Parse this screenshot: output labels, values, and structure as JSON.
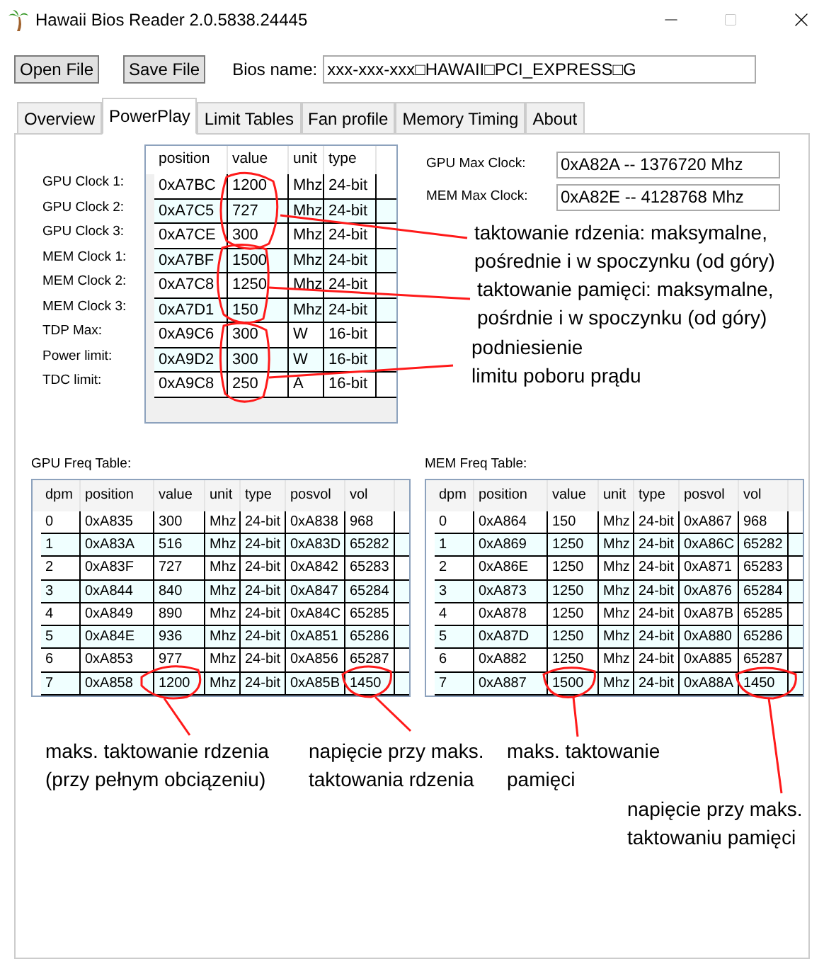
{
  "window": {
    "title": "Hawaii Bios Reader 2.0.5838.24445"
  },
  "toolbar": {
    "buttons": [
      "Open File",
      "Save File"
    ],
    "bios_name": {
      "label": "Bios name:",
      "value": "xxx-xxx-xxx□HAWAII□PCI_EXPRESS□G"
    }
  },
  "tabs": [
    {
      "label": "Overview",
      "selected": false
    },
    {
      "label": "PowerPlay",
      "selected": true
    },
    {
      "label": "Limit Tables",
      "selected": false
    },
    {
      "label": "Fan profile",
      "selected": false
    },
    {
      "label": "Memory Timing",
      "selected": false
    },
    {
      "label": "About",
      "selected": false
    }
  ],
  "powerplay": {
    "columns": [
      "position",
      "value",
      "unit",
      "type"
    ],
    "rows": [
      {
        "label": "GPU Clock 1:",
        "cells": [
          "0xA7BC",
          "1200",
          "Mhz",
          "24-bit"
        ]
      },
      {
        "label": "GPU Clock 2:",
        "cells": [
          "0xA7C5",
          "727",
          "Mhz",
          "24-bit"
        ]
      },
      {
        "label": "GPU Clock 3:",
        "cells": [
          "0xA7CE",
          "300",
          "Mhz",
          "24-bit"
        ]
      },
      {
        "label": "MEM Clock 1:",
        "cells": [
          "0xA7BF",
          "1500",
          "Mhz",
          "24-bit"
        ]
      },
      {
        "label": "MEM Clock 2:",
        "cells": [
          "0xA7C8",
          "1250",
          "Mhz",
          "24-bit"
        ]
      },
      {
        "label": "MEM Clock 3:",
        "cells": [
          "0xA7D1",
          "150",
          "Mhz",
          "24-bit"
        ]
      },
      {
        "label": "TDP Max:",
        "cells": [
          "0xA9C6",
          "300",
          "W",
          "16-bit"
        ]
      },
      {
        "label": "Power limit:",
        "cells": [
          "0xA9D2",
          "300",
          "W",
          "16-bit"
        ]
      },
      {
        "label": "TDC limit:",
        "cells": [
          "0xA9C8",
          "250",
          "A",
          "16-bit"
        ]
      }
    ]
  },
  "max_clocks": [
    {
      "label": "GPU Max Clock:",
      "value": "0xA82A -- 1376720 Mhz"
    },
    {
      "label": "MEM Max Clock:",
      "value": "0xA82E -- 4128768 Mhz"
    }
  ],
  "freq_tables": [
    {
      "title": "GPU Freq Table:",
      "columns": [
        "dpm",
        "position",
        "value",
        "unit",
        "type",
        "posvol",
        "vol"
      ],
      "rows": [
        [
          "0",
          "0xA835",
          "300",
          "Mhz",
          "24-bit",
          "0xA838",
          "968"
        ],
        [
          "1",
          "0xA83A",
          "516",
          "Mhz",
          "24-bit",
          "0xA83D",
          "65282"
        ],
        [
          "2",
          "0xA83F",
          "727",
          "Mhz",
          "24-bit",
          "0xA842",
          "65283"
        ],
        [
          "3",
          "0xA844",
          "840",
          "Mhz",
          "24-bit",
          "0xA847",
          "65284"
        ],
        [
          "4",
          "0xA849",
          "890",
          "Mhz",
          "24-bit",
          "0xA84C",
          "65285"
        ],
        [
          "5",
          "0xA84E",
          "936",
          "Mhz",
          "24-bit",
          "0xA851",
          "65286"
        ],
        [
          "6",
          "0xA853",
          "977",
          "Mhz",
          "24-bit",
          "0xA856",
          "65287"
        ],
        [
          "7",
          "0xA858",
          "1200",
          "Mhz",
          "24-bit",
          "0xA85B",
          "1450"
        ]
      ]
    },
    {
      "title": "MEM Freq Table:",
      "columns": [
        "dpm",
        "position",
        "value",
        "unit",
        "type",
        "posvol",
        "vol"
      ],
      "rows": [
        [
          "0",
          "0xA864",
          "150",
          "Mhz",
          "24-bit",
          "0xA867",
          "968"
        ],
        [
          "1",
          "0xA869",
          "1250",
          "Mhz",
          "24-bit",
          "0xA86C",
          "65282"
        ],
        [
          "2",
          "0xA86E",
          "1250",
          "Mhz",
          "24-bit",
          "0xA871",
          "65283"
        ],
        [
          "3",
          "0xA873",
          "1250",
          "Mhz",
          "24-bit",
          "0xA876",
          "65284"
        ],
        [
          "4",
          "0xA878",
          "1250",
          "Mhz",
          "24-bit",
          "0xA87B",
          "65285"
        ],
        [
          "5",
          "0xA87D",
          "1250",
          "Mhz",
          "24-bit",
          "0xA880",
          "65286"
        ],
        [
          "6",
          "0xA882",
          "1250",
          "Mhz",
          "24-bit",
          "0xA885",
          "65287"
        ],
        [
          "7",
          "0xA887",
          "1500",
          "Mhz",
          "24-bit",
          "0xA88A",
          "1450"
        ]
      ]
    }
  ],
  "annotations": [
    {
      "lines": [
        "taktowanie rdzenia: maksymalne,",
        "pośrednie i w spoczynku (od góry)"
      ]
    },
    {
      "lines": [
        "taktowanie pamięci: maksymalne,",
        "pośrdnie i w spoczynku (od góry)"
      ]
    },
    {
      "lines": [
        "podniesienie",
        "limitu poboru prądu"
      ]
    },
    {
      "lines": [
        "maks. taktowanie rdzenia",
        "(przy pełnym obciązeniu)"
      ]
    },
    {
      "lines": [
        "napięcie przy maks.",
        "taktowania rdzenia"
      ]
    },
    {
      "lines": [
        "maks. taktowanie",
        "pamięci"
      ]
    },
    {
      "lines": [
        "napięcie przy maks.",
        "taktowaniu pamięci"
      ]
    }
  ]
}
